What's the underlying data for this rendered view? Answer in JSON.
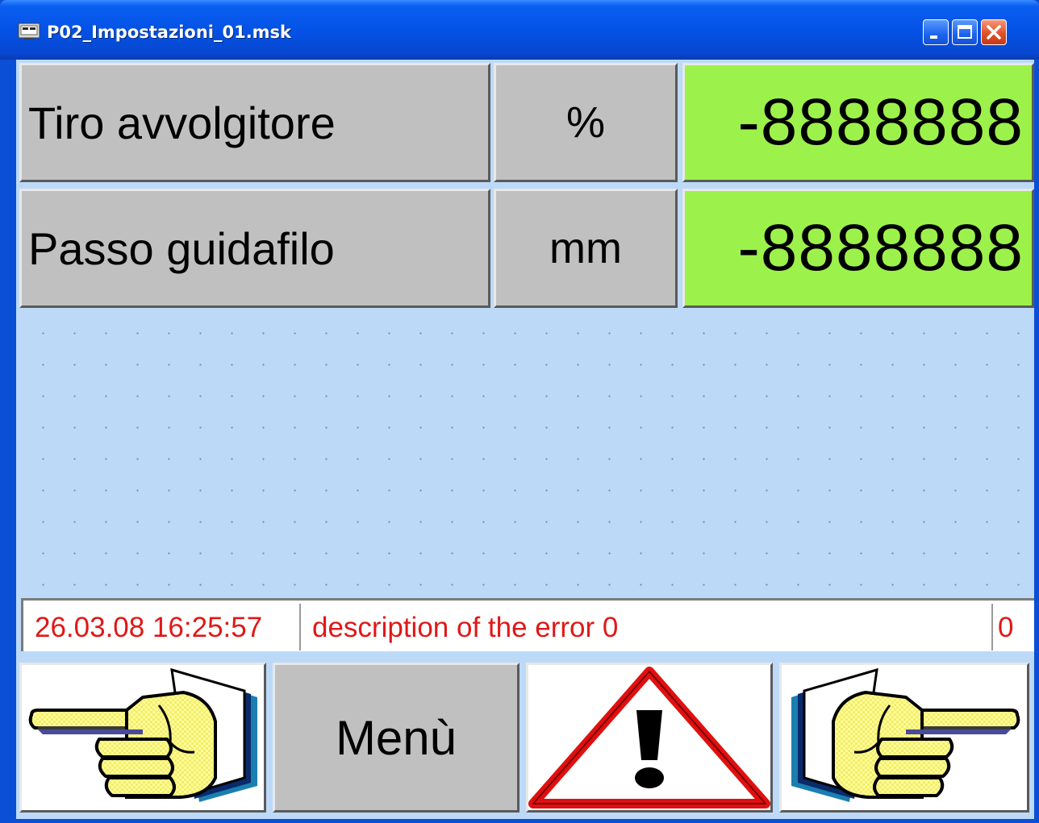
{
  "window": {
    "title": "P02_Impostazioni_01.msk"
  },
  "rows": [
    {
      "label": "Tiro avvolgitore",
      "unit": "%",
      "value": "-8888888"
    },
    {
      "label": "Passo guidafilo",
      "unit": "mm",
      "value": "-8888888"
    }
  ],
  "status": {
    "timestamp": "26.03.08 16:25:57",
    "description": "description of the error 0",
    "count": "0"
  },
  "buttons": {
    "menu_label": "Menù",
    "prev_icon": "hand-pointing-left-icon",
    "alarm_icon": "warning-triangle-icon",
    "next_icon": "hand-pointing-right-icon"
  },
  "colors": {
    "value_bg": "#9cf24a",
    "panel_bg": "#bcdaf8",
    "status_text": "#e01818",
    "cell_bg": "#c0c0c0"
  }
}
